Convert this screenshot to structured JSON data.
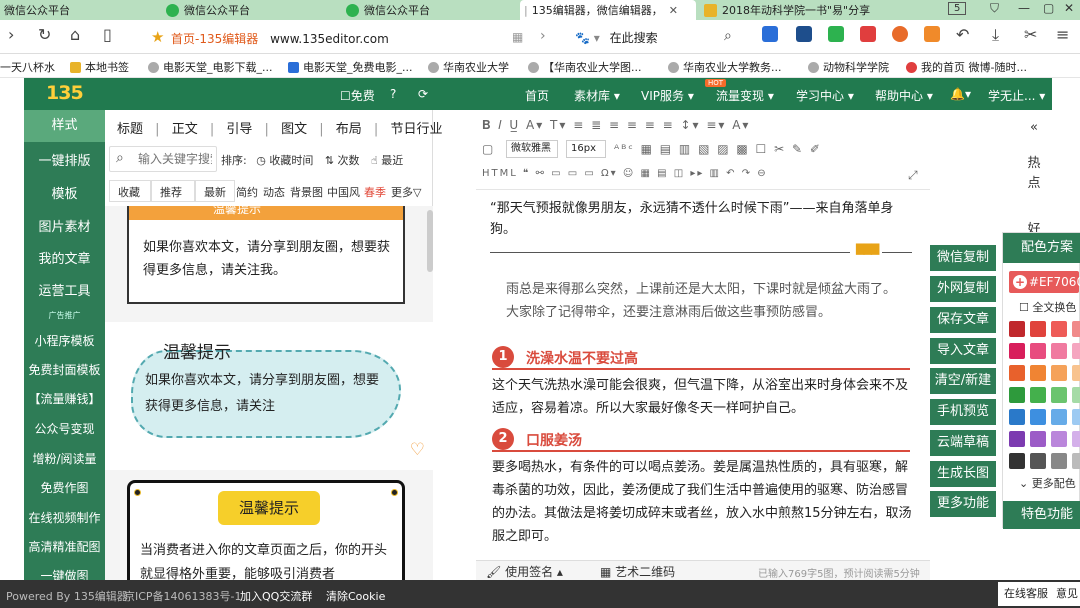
{
  "tabs": [
    {
      "label": "微信公众平台"
    },
    {
      "label": "微信公众平台"
    },
    {
      "label": "微信公众平台"
    },
    {
      "label": "135编辑器，微信编辑器，"
    },
    {
      "label": "2018年动科学院一书\"易\"分享"
    }
  ],
  "tab_counter": "5",
  "nav": {
    "site_name": "首页-135编辑器",
    "url": "www.135editor.com",
    "search_placeholder": "在此搜索"
  },
  "bookmarks": [
    "一天八杯水",
    "本地书签",
    "电影天堂_电影下载_...",
    "电影天堂_免费电影_...",
    "华南农业大学",
    "【华南农业大学图...",
    "华南农业大学教务...",
    "动物科学学院",
    "我的首页 微博-随时..."
  ],
  "header": {
    "logo": "135",
    "free_label": "免费",
    "hot_badge": "HOT",
    "menu": [
      "首页",
      "素材库",
      "VIP服务",
      "流量变现",
      "学习中心",
      "帮助中心"
    ],
    "user": "学无止..."
  },
  "sidebar": {
    "items": [
      "样式",
      "一键排版",
      "模板",
      "图片素材",
      "我的文章",
      "运营工具",
      "广告推广",
      "小程序模板",
      "免费封面模板",
      "【流量赚钱】",
      "公众号变现",
      "增粉/阅读量",
      "免费作图",
      "在线视频制作",
      "高清精准配图",
      "一键做图"
    ]
  },
  "panel": {
    "categories": [
      "标题",
      "正文",
      "引导",
      "图文",
      "布局",
      "节日行业"
    ],
    "search_placeholder": "输入关键字搜索",
    "sort_label": "排序:",
    "sort_options": [
      "收藏时间",
      "次数",
      "最近"
    ],
    "filters": [
      "收藏",
      "推荐",
      "最新"
    ],
    "styles": [
      "简约",
      "动态",
      "背景图",
      "中国风",
      "春季",
      "更多▽"
    ],
    "tpl1_title": "温馨提示",
    "tpl1_text": "如果你喜欢本文，请分享到朋友圈，想要获得更多信息，请关注我。",
    "tpl2_title": "温馨提示",
    "tpl2_text": "如果你喜欢本文，请分享到朋友圈，想要获得更多信息，请关注",
    "tpl3_title": "温馨提示",
    "tpl3_text": "当消费者进入你的文章页面之后，你的开头就显得格外重要，能够吸引消费者"
  },
  "editor": {
    "font_family": "微软雅黑",
    "font_size": "16px",
    "quote": "“那天气预报就像男朋友，永远猜不透什么时候下雨”——来自角落单身狗。",
    "intro": "雨总是来得那么突然，上课前还是大太阳，下课时就是倾盆大雨了。大家除了记得带伞，还要注意淋雨后做这些事预防感冒。",
    "sections": [
      {
        "num": "1",
        "title": "洗澡水温不要过高",
        "body": "这个天气洗热水澡可能会很爽，但气温下降，从浴室出来时身体会来不及适应，容易着凉。所以大家最好像冬天一样呵护自己。"
      },
      {
        "num": "2",
        "title": "口服姜汤",
        "body": "要多喝热水，有条件的可以喝点姜汤。姜是属温热性质的，具有驱寒，解毒杀菌的功效，因此，姜汤便成了我们生活中普遍使用的驱寒、防治感冒的办法。其做法是将姜切成碎末或者丝，放入水中煎熬15分钟左右，取汤服之即可。"
      }
    ],
    "signature_label": "使用签名",
    "qr_label": "艺术二维码",
    "stats": "已输入769字5图，预计阅读需5分钟"
  },
  "actions": [
    "微信复制",
    "外网复制",
    "保存文章",
    "导入文章",
    "清空/新建",
    "手机预览",
    "云端草稿",
    "生成长图",
    "更多功能"
  ],
  "color_panel": {
    "title": "配色方案",
    "current": "#EF7060",
    "all_label": "全文换色",
    "more_label": "更多配色",
    "feature_label": "特色功能",
    "swatches": [
      "#c0282c",
      "#e0433c",
      "#ee5b57",
      "#f08a8a",
      "#d81e5b",
      "#e84c7f",
      "#f07aa0",
      "#f5a6c0",
      "#e8612c",
      "#f08433",
      "#f5a25a",
      "#f8c38f",
      "#2e9a3c",
      "#44b04c",
      "#6bc46e",
      "#a5dba6",
      "#2a79c9",
      "#3d8fe0",
      "#66abe8",
      "#9dcaf2",
      "#7c3bb0",
      "#9c5cc7",
      "#ba86db",
      "#d4b0ea",
      "#333333",
      "#555555",
      "#888888",
      "#bbbbbb"
    ]
  },
  "right_side": {
    "collapse": "«",
    "items": [
      "热点",
      "好"
    ]
  },
  "footer": {
    "powered": "Powered By 135编辑器",
    "icp": "京ICP备14061383号-1",
    "qq": "加入QQ交流群",
    "cookie": "清除Cookie",
    "service": "在线客服",
    "feedback": "意见"
  }
}
